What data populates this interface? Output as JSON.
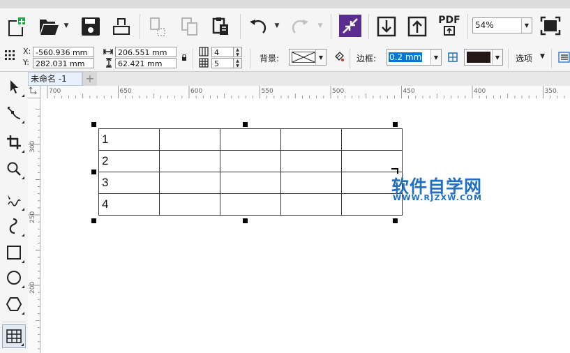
{
  "toolbar": {
    "pdf_label": "PDF",
    "zoom": {
      "value": "54%"
    }
  },
  "properties": {
    "x_label": "X:",
    "x_value": "-560.936 mm",
    "y_label": "Y:",
    "y_value": "282.031 mm",
    "width_value": "206.551 mm",
    "height_value": "62.421 mm",
    "cols_value": "4",
    "rows_value": "5",
    "background_label": "背景:",
    "border_label": "边框:",
    "border_width_value": "0.2 mm",
    "border_color": "#231815",
    "options_label": "选项"
  },
  "document": {
    "tab_title": "未命名 -1",
    "add_tab_glyph": "+"
  },
  "ruler": {
    "h_labels": [
      "700",
      "650",
      "600",
      "550",
      "500",
      "450",
      "400",
      "350"
    ],
    "v_labels": [
      "300",
      "250",
      "200"
    ]
  },
  "table": {
    "rows": [
      [
        "1",
        "",
        "",
        "",
        ""
      ],
      [
        "2",
        "",
        "",
        "",
        ""
      ],
      [
        "3",
        "",
        "",
        "",
        ""
      ],
      [
        "4",
        "",
        "",
        "",
        ""
      ]
    ]
  },
  "watermark": {
    "title": "软件自学网",
    "url": "WWW.RJZXW.COM"
  },
  "colors": {
    "accent_purple": "#5b2d8e",
    "selection_blue": "#0078d7",
    "watermark_blue": "#1f6fc2"
  }
}
